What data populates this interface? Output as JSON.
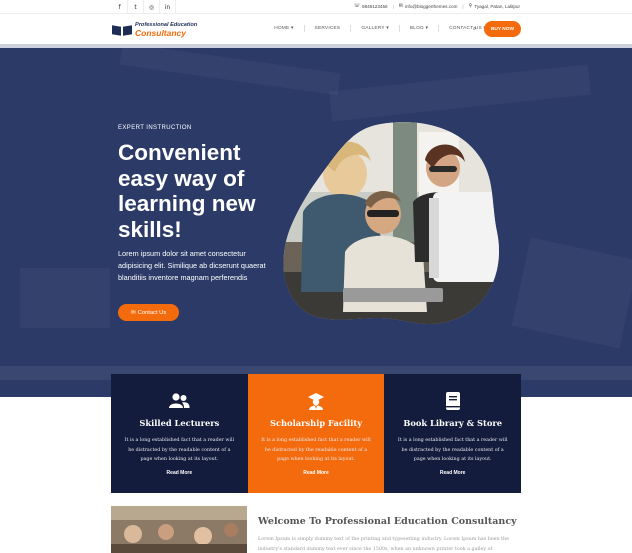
{
  "topbar": {
    "social": [
      "f",
      "t",
      "◎",
      "in"
    ],
    "phone": "9848123456",
    "email": "info@bloggerthemes.com",
    "address": "Tyagal, Patan, Lalitpur"
  },
  "header": {
    "logo_line1": "Professional Education",
    "logo_line2": "Consultancy",
    "nav": [
      {
        "label": "HOME ▾"
      },
      {
        "label": "SERVICES"
      },
      {
        "label": "GALLERY ▾"
      },
      {
        "label": "BLOG ▾"
      },
      {
        "label": "CONTACT US ▾"
      }
    ],
    "buy_label": "BUY NOW"
  },
  "hero": {
    "eyebrow": "EXPERT INSTRUCTION",
    "title": "Convenient easy way of learning new skills!",
    "text": "Lorem ipsum dolor sit amet consectetur adipisicing elit. Similique ab dicserunt quaerat blanditiis inventore magnam perferendis",
    "button_label": "Contact Us"
  },
  "features": [
    {
      "title": "Skilled Lecturers",
      "text": "It is a long established fact that a reader will be distracted by the readable content of a page when looking at its layout.",
      "more": "Read More",
      "icon": "users-icon"
    },
    {
      "title": "Scholarship Facility",
      "text": "It is a long established fact that a reader will be distracted by the readable content of a page when looking at its layout.",
      "more": "Read More",
      "icon": "graduate-icon"
    },
    {
      "title": "Book Library & Store",
      "text": "It is a long established fact that a reader will be distracted by the readable content of a page when looking at its layout.",
      "more": "Read More",
      "icon": "book-icon"
    }
  ],
  "welcome": {
    "title": "Welcome To Professional Education Consultancy",
    "text": "Lorem Ipsum is simply dummy text of the printing and typesetting industry. Lorem Ipsum has been the industry's standard dummy text ever since the 1500s, when an unknown printer took a galley of"
  },
  "colors": {
    "accent": "#f46b0d",
    "hero_bg": "#2c3a67",
    "card_dark": "#131c3c",
    "brand": "#1e2d56"
  }
}
